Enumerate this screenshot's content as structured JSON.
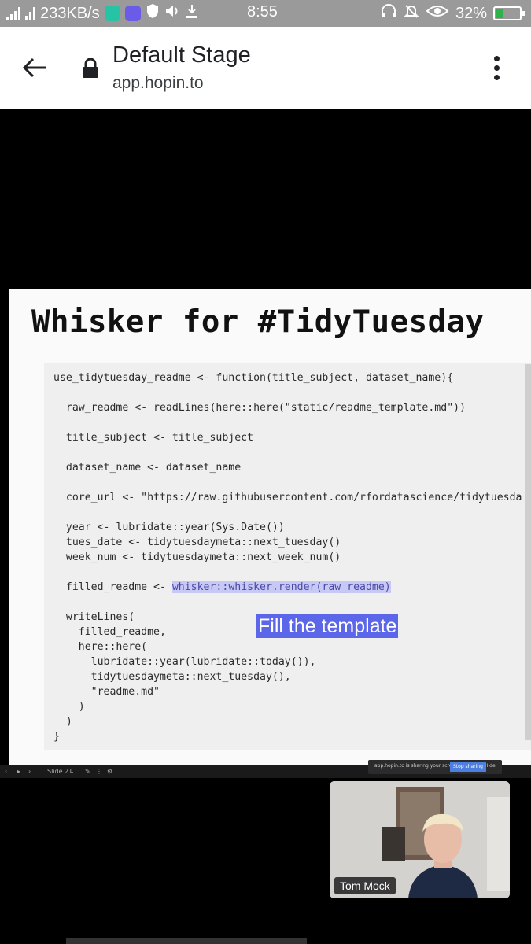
{
  "status_bar": {
    "network_speed": "233KB/s",
    "time": "8:55",
    "battery_percent": "32%",
    "battery_level": 0.32,
    "icons": [
      "signal-icon",
      "hotspot-icon",
      "app-icon",
      "app-icon",
      "shield-icon",
      "volume-icon",
      "download-icon",
      "headphones-icon",
      "alarm-off-icon",
      "eye-icon",
      "battery-charging-icon"
    ]
  },
  "browser": {
    "title": "Default Stage",
    "url": "app.hopin.to",
    "back_icon": "back-arrow-icon",
    "lock_icon": "lock-icon",
    "menu_icon": "more-vert-icon"
  },
  "slide": {
    "title": "Whisker for #TidyTuesday",
    "code_lines": [
      "use_tidytuesday_readme <- function(title_subject, dataset_name){",
      "  raw_readme <- readLines(here::here(\"static/readme_template.md\"))",
      "  title_subject <- title_subject",
      "  dataset_name <- dataset_name",
      "  core_url <- \"https://raw.githubusercontent.com/rfordatascience/tidytuesda",
      "  year <- lubridate::year(Sys.Date())",
      "  tues_date <- tidytuesdaymeta::next_tuesday()",
      "  week_num <- tidytuesdaymeta::next_week_num()",
      "  filled_readme <- ",
      "  writeLines(",
      "    filled_readme,",
      "    here::here(",
      "      lubridate::year(lubridate::today()),",
      "      tidytuesdaymeta::next_tuesday(),",
      "      \"readme.md\"",
      "    )",
      "  )",
      "}"
    ],
    "highlighted_code": "whisker::whisker.render(raw_readme)",
    "callout": "Fill the template",
    "accent_color": "#5b67e8",
    "highlight_color": "#c8c8f5"
  },
  "video_controls": {
    "slide_counter": "Slide 21",
    "share_notice": "app.hopin.to is sharing your screen.",
    "stop_sharing": "Stop sharing",
    "hide": "Hide"
  },
  "camera": {
    "speaker_name": "Tom Mock"
  }
}
